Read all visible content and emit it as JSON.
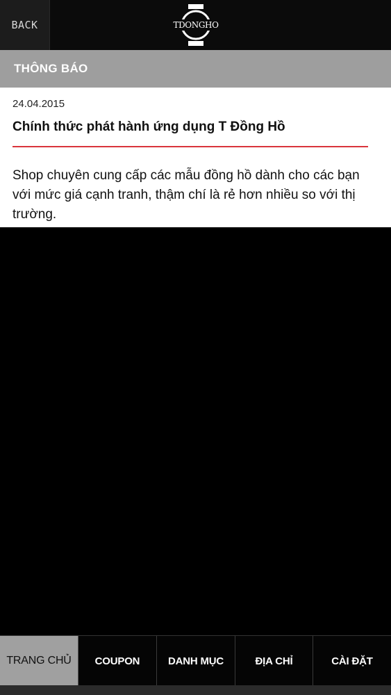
{
  "header": {
    "back_label": "BACK",
    "logo_text": "TDONGHO",
    "logo_icon": "watch-logo-icon"
  },
  "section": {
    "title": "THÔNG BÁO"
  },
  "notification": {
    "date": "24.04.2015",
    "title": "Chính thức phát hành ứng dụng T Đồng Hồ",
    "body": "Shop chuyên cung cấp các mẫu đồng hồ dành cho các bạn với mức giá cạnh tranh, thậm chí là rẻ hơn nhiều so với thị trường.",
    "accent_color": "#d9343b"
  },
  "tabs": [
    {
      "label": "TRANG CHỦ",
      "active": true
    },
    {
      "label": "COUPON",
      "active": false
    },
    {
      "label": "DANH MỤC",
      "active": false
    },
    {
      "label": "ĐỊA CHỈ",
      "active": false
    },
    {
      "label": "CÀI ĐẶT",
      "active": false
    }
  ]
}
